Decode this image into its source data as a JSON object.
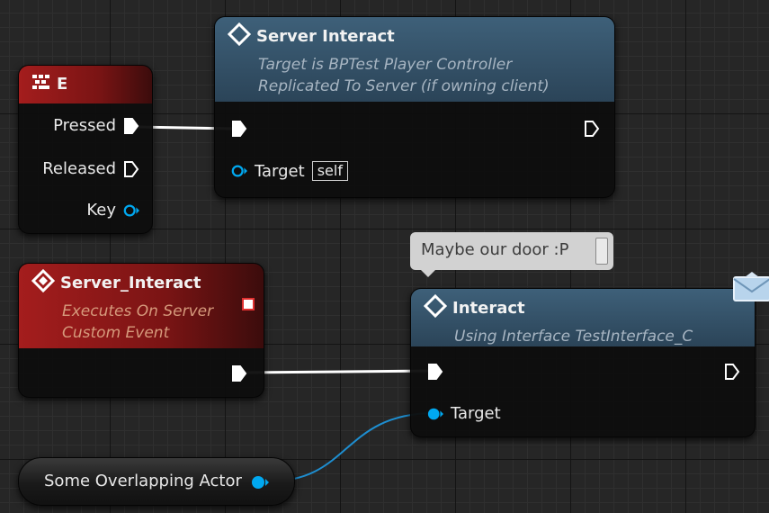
{
  "graph": {
    "key_event": {
      "title": "E",
      "pins": {
        "pressed": "Pressed",
        "released": "Released",
        "key": "Key"
      }
    },
    "server_interact_call": {
      "title": "Server Interact",
      "subtitle_1": "Target is BPTest Player Controller",
      "subtitle_2": "Replicated To Server (if owning client)",
      "target_label": "Target",
      "target_default": "self"
    },
    "custom_event": {
      "title": "Server_Interact",
      "subtitle_1": "Executes On Server",
      "subtitle_2": "Custom Event"
    },
    "comment": {
      "text": "Maybe our door :P"
    },
    "interact_call": {
      "title": "Interact",
      "subtitle": "Using Interface TestInterface_C",
      "target_label": "Target"
    },
    "variable": {
      "label": "Some Overlapping Actor"
    }
  },
  "colors": {
    "exec_wire": "#ffffff",
    "object_pin": "#00a8f0",
    "function_header": "#3e6079",
    "event_header": "#a41d1d",
    "comment_bg": "#d2d2d2"
  },
  "icons": {
    "function": "function-diamond-icon",
    "keyboard": "keyboard-icon",
    "event": "event-diamond-icon",
    "interface_message": "envelope-icon",
    "replicated": "red-square-icon"
  }
}
